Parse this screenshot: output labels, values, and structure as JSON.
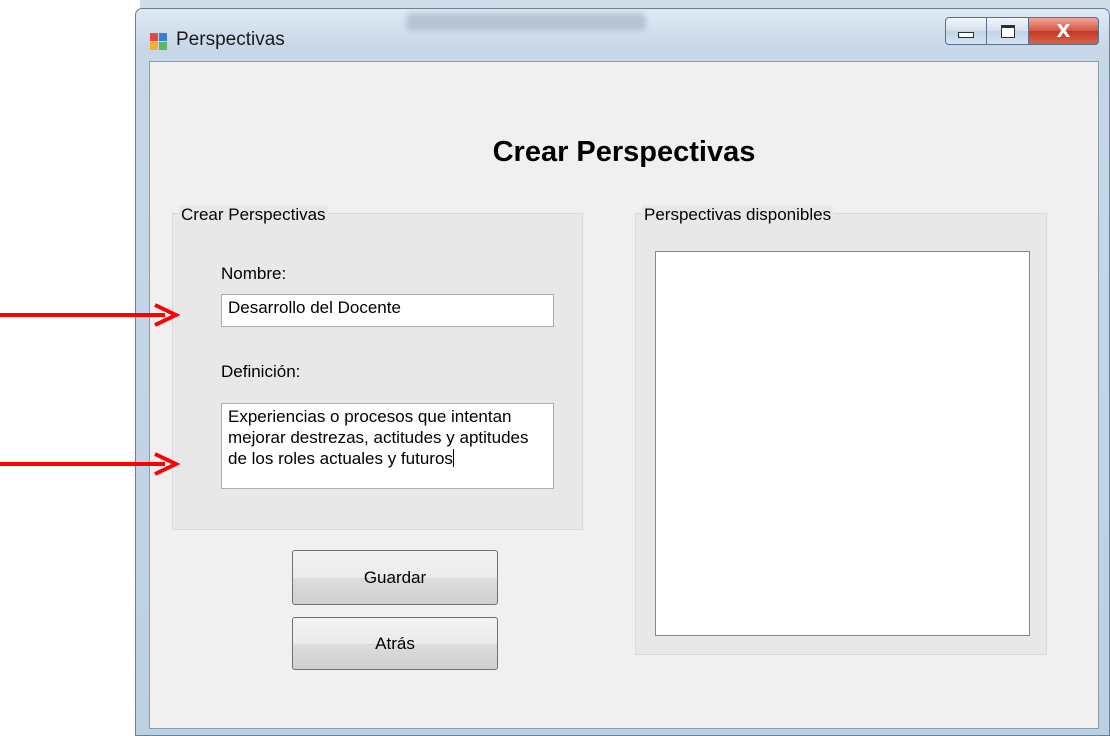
{
  "window": {
    "title": "Perspectivas",
    "controls": {
      "minimize_icon": "minimize-icon",
      "maximize_icon": "maximize-icon",
      "close_label": "X"
    }
  },
  "form": {
    "heading": "Crear Perspectivas",
    "create_group": {
      "legend": "Crear Perspectivas",
      "name_label": "Nombre:",
      "name_value": "Desarrollo del Docente",
      "definition_label": "Definición:",
      "definition_value": "Experiencias o procesos que intentan\nmejorar destrezas, actitudes y aptitudes\nde los roles actuales y futuros"
    },
    "available_group": {
      "legend": "Perspectivas disponibles",
      "items": []
    },
    "buttons": {
      "save": "Guardar",
      "back": "Atrás"
    }
  },
  "annotations": {
    "arrow_color": "#ff0000"
  }
}
